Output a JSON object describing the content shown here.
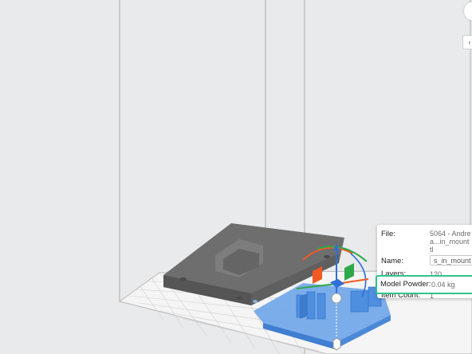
{
  "info_panel": {
    "file_label": "File:",
    "file_value_line1": "5064 - Andre",
    "file_value_line2": "a...in_mount",
    "file_value_line3": "tl",
    "name_label": "Name:",
    "name_value": "s_in_mount",
    "layers_label": "Layers:",
    "layers_value": "120",
    "model_powder_label": "Model Powder:",
    "model_powder_value": "0.04 kg",
    "item_count_label": "Item Count:",
    "item_count_value": "1"
  },
  "colors": {
    "background": "#e9eaeb",
    "model_gray": "#6e6e6e",
    "selected_blue": "#4f8fe0",
    "highlight_green": "#2ec48a",
    "gizmo_orange": "#f05a22",
    "gizmo_green": "#2ea84a",
    "gizmo_blue": "#2f6fd6"
  },
  "icons": {
    "side_toggle": "chevron-left-icon"
  },
  "side_toggle_glyph": "‹"
}
